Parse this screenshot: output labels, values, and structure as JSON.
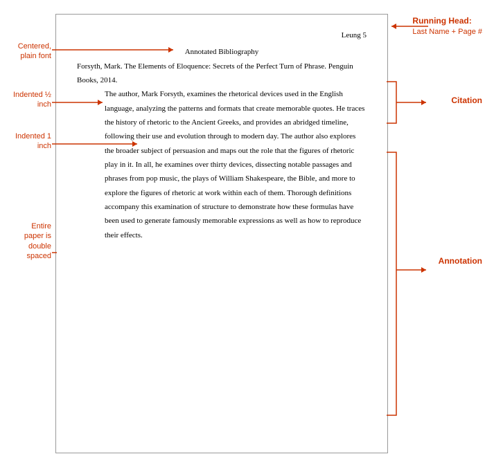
{
  "document": {
    "header": {
      "last_name_page": "Leung 5"
    },
    "title": "Annotated Bibliography",
    "citation": {
      "author": "Forsyth, Mark. ",
      "title_italic": "The Elements of Eloquence: Secrets of the Perfect Turn of Phrase.",
      "publisher": " Penguin Books, 2014."
    },
    "annotation_text": "The author, Mark Forsyth, examines the rhetorical devices used in the English language, analyzing the patterns and formats that create memorable quotes. He traces the history of rhetoric to the Ancient Greeks, and provides an abridged timeline, following their use and evolution through to modern day. The author also explores the broader subject of persuasion and maps out the role that the figures of rhetoric play in it. In all, he examines over thirty devices, dissecting notable passages and phrases from pop music, the plays of William Shakespeare, the Bible, and more to explore the figures of rhetoric at work within each of them. Thorough definitions accompany this examination of structure to demonstrate how these formulas have been used to generate famously memorable expressions as well as how to reproduce their effects."
  },
  "labels": {
    "running_head_title": "Running Head:",
    "running_head_subtitle": "Last Name + Page #",
    "centered": "Centered, plain font",
    "indented_half": "Indented ½ inch",
    "indented_one": "Indented 1 inch",
    "double_spaced_line1": "Entire",
    "double_spaced_line2": "paper is",
    "double_spaced_line3": "double",
    "double_spaced_line4": "spaced",
    "citation": "Citation",
    "annotation": "Annotation"
  }
}
